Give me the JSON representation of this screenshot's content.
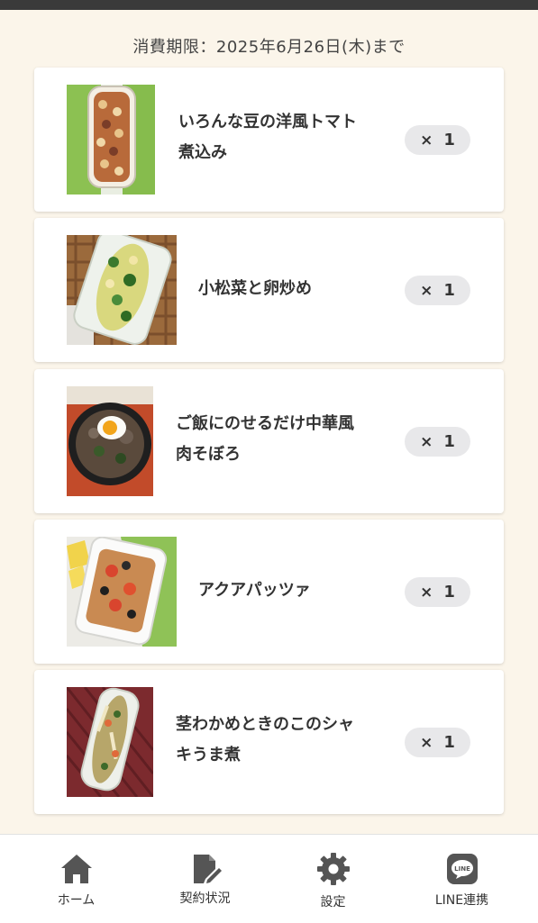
{
  "expiry_text": "消費期限：2025年6月26日(木)まで",
  "items": [
    {
      "name_line1": "いろんな豆の洋風トマト",
      "name_line2": "煮込み",
      "qty_x": "×",
      "qty_n": "1"
    },
    {
      "name_line1": "小松菜と卵炒め",
      "name_line2": "",
      "qty_x": "×",
      "qty_n": "1"
    },
    {
      "name_line1": "ご飯にのせるだけ中華風",
      "name_line2": "肉そぼろ",
      "qty_x": "×",
      "qty_n": "1"
    },
    {
      "name_line1": "アクアパッツァ",
      "name_line2": "",
      "qty_x": "×",
      "qty_n": "1"
    },
    {
      "name_line1": "茎わかめときのこのシャ",
      "name_line2": "キうま煮",
      "qty_x": "×",
      "qty_n": "1"
    }
  ],
  "tabs": [
    {
      "label": "ホーム",
      "icon": "home-icon"
    },
    {
      "label": "契約状況",
      "icon": "contract-icon"
    },
    {
      "label": "設定",
      "icon": "gear-icon"
    },
    {
      "label": "LINE連携",
      "icon": "line-icon",
      "badge": "LINE"
    }
  ]
}
